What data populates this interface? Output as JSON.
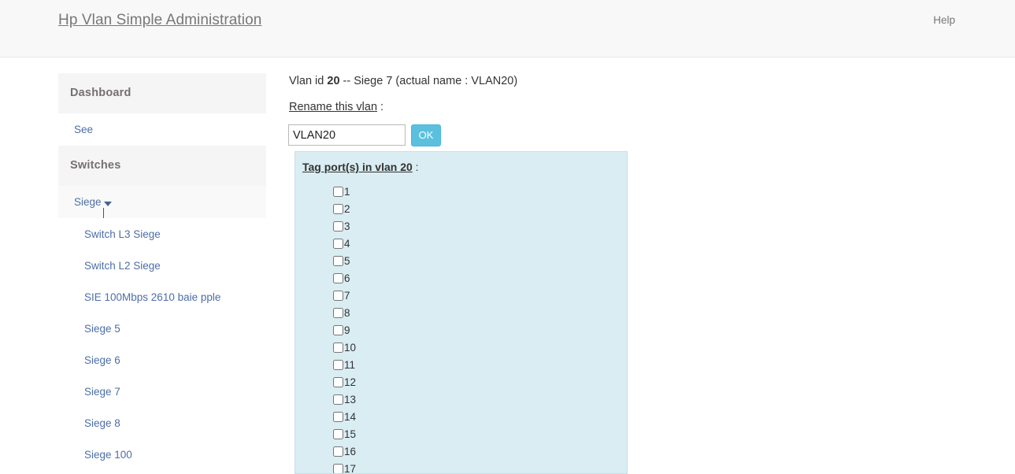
{
  "navbar": {
    "brand": "Hp Vlan Simple Administration",
    "help_label": "Help"
  },
  "sidebar": {
    "sections": [
      {
        "header": "Dashboard",
        "items": [
          {
            "label": "See",
            "indent": false,
            "shaded": false,
            "caret": false
          }
        ]
      },
      {
        "header": "Switches",
        "items": [
          {
            "label": "Siege",
            "indent": false,
            "shaded": true,
            "caret": true
          },
          {
            "label": "Switch L3 Siege",
            "indent": true,
            "shaded": false,
            "caret": false
          },
          {
            "label": "Switch L2 Siege",
            "indent": true,
            "shaded": false,
            "caret": false
          },
          {
            "label": "SIE 100Mbps 2610 baie pple",
            "indent": true,
            "shaded": false,
            "caret": false
          },
          {
            "label": "Siege 5",
            "indent": true,
            "shaded": false,
            "caret": false
          },
          {
            "label": "Siege 6",
            "indent": true,
            "shaded": false,
            "caret": false
          },
          {
            "label": "Siege 7",
            "indent": true,
            "shaded": false,
            "caret": false
          },
          {
            "label": "Siege 8",
            "indent": true,
            "shaded": false,
            "caret": false
          },
          {
            "label": "Siege 100",
            "indent": true,
            "shaded": false,
            "caret": false
          }
        ]
      }
    ]
  },
  "main": {
    "vlan_title_prefix": "Vlan id ",
    "vlan_id": "20",
    "vlan_title_suffix": " -- Siege 7 (actual name : VLAN20)",
    "rename_label": "Rename this vlan",
    "rename_colon": " :",
    "rename_input_value": "VLAN20",
    "rename_input_placeholder": "",
    "ok_label": "OK",
    "ports_panel": {
      "title": "Tag port(s) in vlan 20",
      "title_colon": " :",
      "ports": [
        {
          "label": "1",
          "checked": false
        },
        {
          "label": "2",
          "checked": false
        },
        {
          "label": "3",
          "checked": false
        },
        {
          "label": "4",
          "checked": false
        },
        {
          "label": "5",
          "checked": false
        },
        {
          "label": "6",
          "checked": false
        },
        {
          "label": "7",
          "checked": false
        },
        {
          "label": "8",
          "checked": false
        },
        {
          "label": "9",
          "checked": false
        },
        {
          "label": "10",
          "checked": false
        },
        {
          "label": "11",
          "checked": false
        },
        {
          "label": "12",
          "checked": false
        },
        {
          "label": "13",
          "checked": false
        },
        {
          "label": "14",
          "checked": false
        },
        {
          "label": "15",
          "checked": false
        },
        {
          "label": "16",
          "checked": false
        },
        {
          "label": "17",
          "checked": false
        }
      ]
    }
  },
  "colors": {
    "navbar_bg": "#f8f8f8",
    "section_header_bg": "#f5f5f5",
    "link": "#4d6ea8",
    "panel_bg": "#d9edf3",
    "panel_border": "#c7dfe7",
    "button_bg": "#5bc0de"
  }
}
